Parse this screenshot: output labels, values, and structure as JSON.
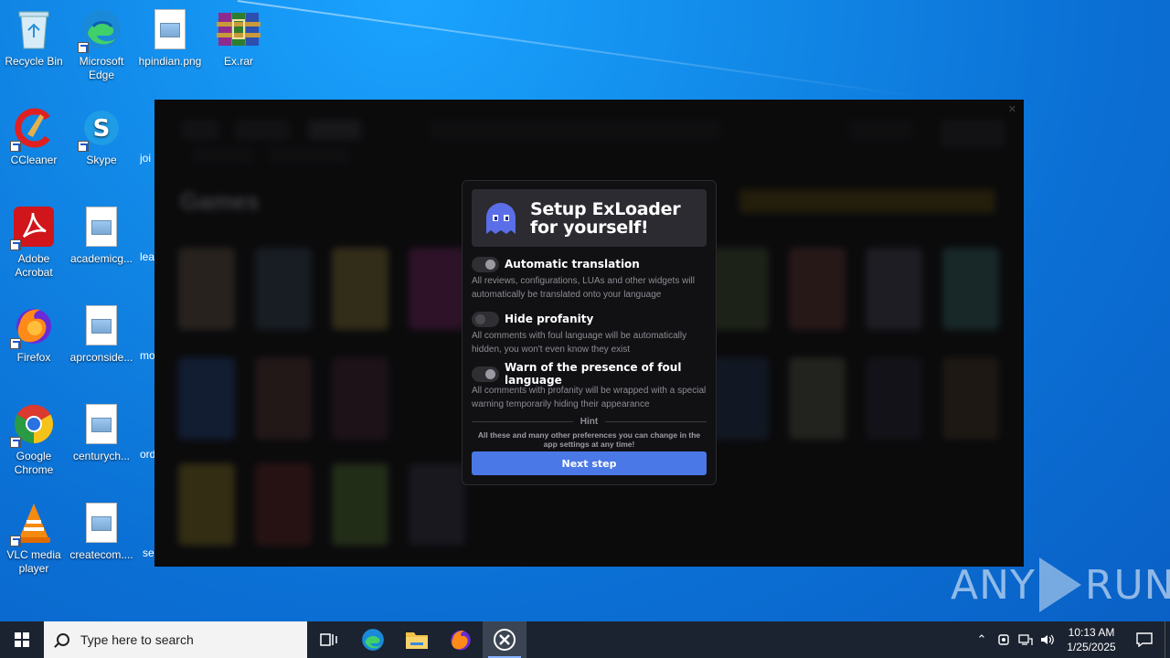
{
  "desktop": {
    "icons": [
      {
        "label": "Recycle Bin"
      },
      {
        "label": "Microsoft Edge"
      },
      {
        "label": "hpindian.png"
      },
      {
        "label": "Ex.rar"
      },
      {
        "label": "CCleaner"
      },
      {
        "label": "Skype"
      },
      {
        "label": "Adobe Acrobat"
      },
      {
        "label": "academicg..."
      },
      {
        "label": "Firefox"
      },
      {
        "label": "aprconside..."
      },
      {
        "label": "Google Chrome"
      },
      {
        "label": "centurych..."
      },
      {
        "label": "VLC media player"
      },
      {
        "label": "createcom...."
      }
    ],
    "partial_labels": [
      "joi",
      "lea",
      "mo",
      "ord",
      "se"
    ]
  },
  "app": {
    "background_heading": "Games"
  },
  "modal": {
    "title": "Setup ExLoader for yourself!",
    "options": [
      {
        "label": "Automatic translation",
        "description": "All reviews, configurations, LUAs and other widgets will automatically be translated onto your language",
        "enabled": true
      },
      {
        "label": "Hide profanity",
        "description": "All comments with foul language will be automatically hidden, you won't even know they exist",
        "enabled": false
      },
      {
        "label": "Warn of the presence of foul language",
        "description": "All comments with profanity will be wrapped with a special warning temporarily hiding their appearance",
        "enabled": true
      }
    ],
    "hint_label": "Hint",
    "hint_text": "All these and many other preferences you can change in the app settings at any time!",
    "next_button": "Next step"
  },
  "watermark": {
    "left": "ANY",
    "right": "RUN"
  },
  "taskbar": {
    "search_placeholder": "Type here to search",
    "clock_time": "10:13 AM",
    "clock_date": "1/25/2025"
  },
  "colors": {
    "accent_button": "#4a78e6",
    "modal_bg": "#111114",
    "taskbar_bg": "#1b2330"
  }
}
